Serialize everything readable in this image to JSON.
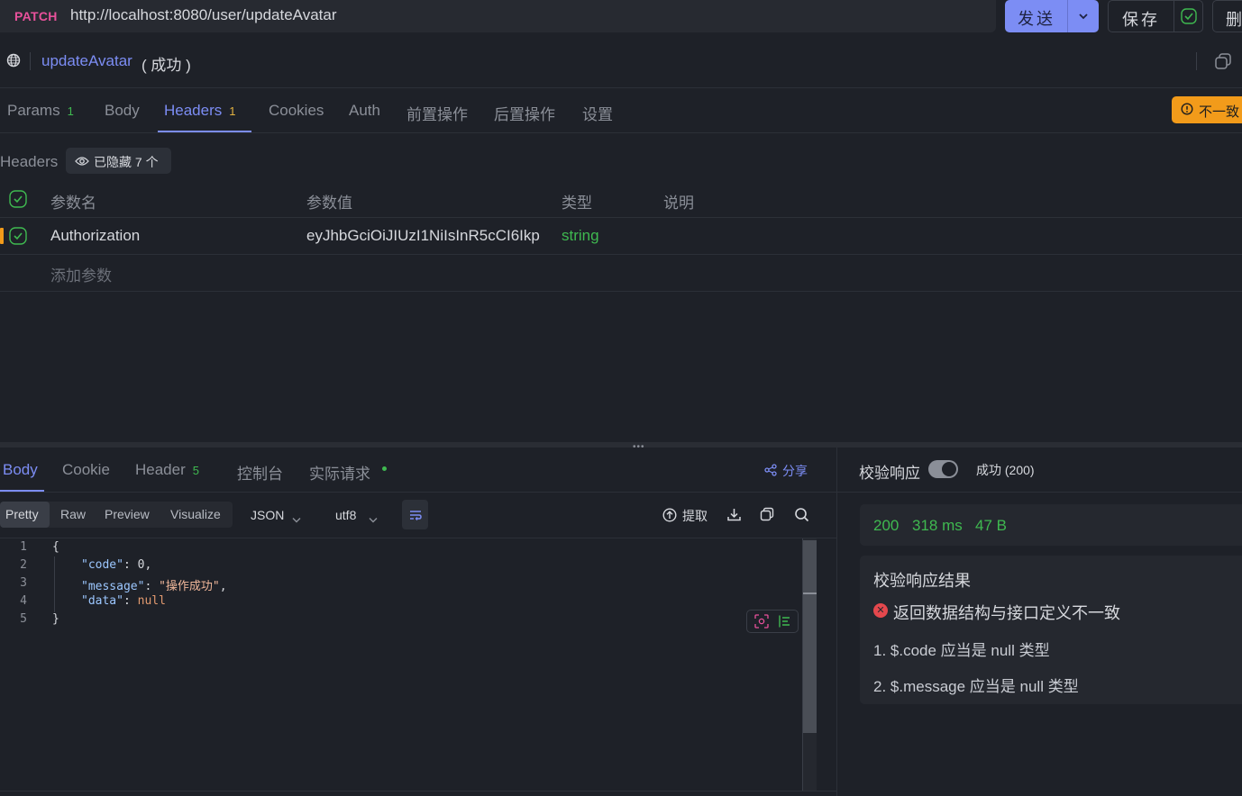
{
  "request": {
    "method": "PATCH",
    "url": "http://localhost:8080/user/updateAvatar",
    "send_label": "发送",
    "save_label": "保存",
    "delete_label": "删"
  },
  "endpoint": {
    "name": "updateAvatar",
    "status": "( 成功 )"
  },
  "tabs": [
    {
      "label": "Params",
      "count": "1"
    },
    {
      "label": "Body",
      "count": ""
    },
    {
      "label": "Headers",
      "count": "1"
    },
    {
      "label": "Cookies",
      "count": ""
    },
    {
      "label": "Auth",
      "count": ""
    },
    {
      "label": "前置操作",
      "count": ""
    },
    {
      "label": "后置操作",
      "count": ""
    },
    {
      "label": "设置",
      "count": ""
    }
  ],
  "active_tab": "Headers",
  "mismatch_badge": "不一致",
  "headers_section": {
    "title": "Headers",
    "hidden_label": "已隐藏 7 个",
    "columns": [
      "参数名",
      "参数值",
      "类型",
      "说明"
    ],
    "rows": [
      {
        "name": "Authorization",
        "value": "eyJhbGciOiJIUzI1NiIsInR5cCI6Ikp",
        "type": "string",
        "desc": ""
      }
    ],
    "add_placeholder": "添加参数"
  },
  "response": {
    "tabs": [
      {
        "label": "Body",
        "count": ""
      },
      {
        "label": "Cookie",
        "count": ""
      },
      {
        "label": "Header",
        "count": "5"
      },
      {
        "label": "控制台",
        "count": ""
      },
      {
        "label": "实际请求",
        "count": ""
      }
    ],
    "share_label": "分享",
    "view_modes": [
      "Pretty",
      "Raw",
      "Preview",
      "Visualize"
    ],
    "format": "JSON",
    "encoding": "utf8",
    "extract_label": "提取",
    "code_lines": [
      {
        "n": "1",
        "text": "{"
      },
      {
        "n": "2",
        "key": "\"code\"",
        "val": "0",
        "vtype": "num",
        "tail": ","
      },
      {
        "n": "3",
        "key": "\"message\"",
        "val": "\"操作成功\"",
        "vtype": "str",
        "tail": ","
      },
      {
        "n": "4",
        "key": "\"data\"",
        "val": "null",
        "vtype": "nul",
        "tail": ""
      },
      {
        "n": "5",
        "text": "}"
      }
    ]
  },
  "validation": {
    "label": "校验响应",
    "status_text": "成功 (200)",
    "metrics": {
      "status": "200",
      "time": "318 ms",
      "size": "47 B"
    },
    "result_title": "校验响应结果",
    "error_title": "返回数据结构与接口定义不一致",
    "errors": [
      "1. $.code 应当是 null 类型",
      "2. $.message 应当是 null 类型"
    ]
  },
  "colors": {
    "accent": "#7c8df4",
    "success": "#3fb950",
    "warning": "#f29b1a",
    "method": "#e8519b",
    "error": "#e5484d"
  }
}
